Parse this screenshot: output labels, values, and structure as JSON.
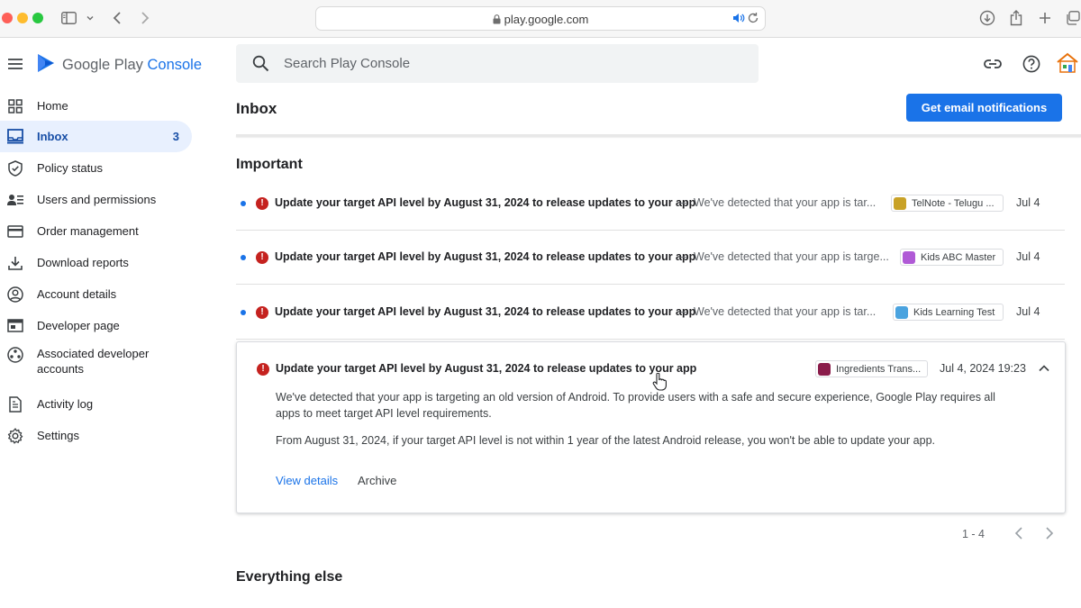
{
  "browser": {
    "url": "play.google.com"
  },
  "app": {
    "logo_google_play": "Google Play",
    "logo_console": "Console"
  },
  "search": {
    "placeholder": "Search Play Console"
  },
  "nav": {
    "items": [
      {
        "label": "Home",
        "icon": "grid-icon"
      },
      {
        "label": "Inbox",
        "icon": "inbox-icon",
        "count": "3",
        "active": true
      },
      {
        "label": "Policy status",
        "icon": "shield-check-icon"
      },
      {
        "label": "Users and permissions",
        "icon": "users-icon"
      },
      {
        "label": "Order management",
        "icon": "credit-card-icon"
      },
      {
        "label": "Download reports",
        "icon": "download-icon"
      },
      {
        "label": "Account details",
        "icon": "account-circle-icon"
      },
      {
        "label": "Developer page",
        "icon": "web-page-icon"
      },
      {
        "label": "Associated developer accounts",
        "icon": "connected-accounts-icon"
      },
      {
        "label": "Activity log",
        "icon": "document-icon"
      },
      {
        "label": "Settings",
        "icon": "gear-icon"
      }
    ]
  },
  "page": {
    "title": "Inbox",
    "email_button": "Get email notifications"
  },
  "sections": {
    "important": "Important",
    "everything_else": "Everything else"
  },
  "messages": [
    {
      "title": "Update your target API level by August 31, 2024 to release updates to your app",
      "separator": "–",
      "snippet": "We've detected that your app is tar...",
      "app": "TelNote - Telugu ...",
      "date": "Jul 4",
      "unread": true
    },
    {
      "title": "Update your target API level by August 31, 2024 to release updates to your app",
      "separator": "–",
      "snippet": "We've detected that your app is targe...",
      "app": "Kids ABC Master",
      "date": "Jul 4",
      "unread": true
    },
    {
      "title": "Update your target API level by August 31, 2024 to release updates to your app",
      "separator": "–",
      "snippet": "We've detected that your app is tar...",
      "app": "Kids Learning Test",
      "date": "Jul 4",
      "unread": true
    }
  ],
  "expanded_message": {
    "title": "Update your target API level by August 31, 2024 to release updates to your app",
    "app": "Ingredients Trans...",
    "date": "Jul 4, 2024 19:23",
    "body_1": "We've detected that your app is targeting an old version of Android. To provide users with a safe and secure experience, Google Play requires all apps to meet target API level requirements.",
    "body_2": "From August 31, 2024, if your target API level is not within 1 year of the latest Android release, you won't be able to update your app.",
    "view_details": "View details",
    "archive": "Archive"
  },
  "pagination": {
    "range": "1 - 4"
  },
  "colors": {
    "accent": "#1a73e8",
    "error": "#c5221f",
    "active_nav_bg": "#e8f0fe"
  }
}
